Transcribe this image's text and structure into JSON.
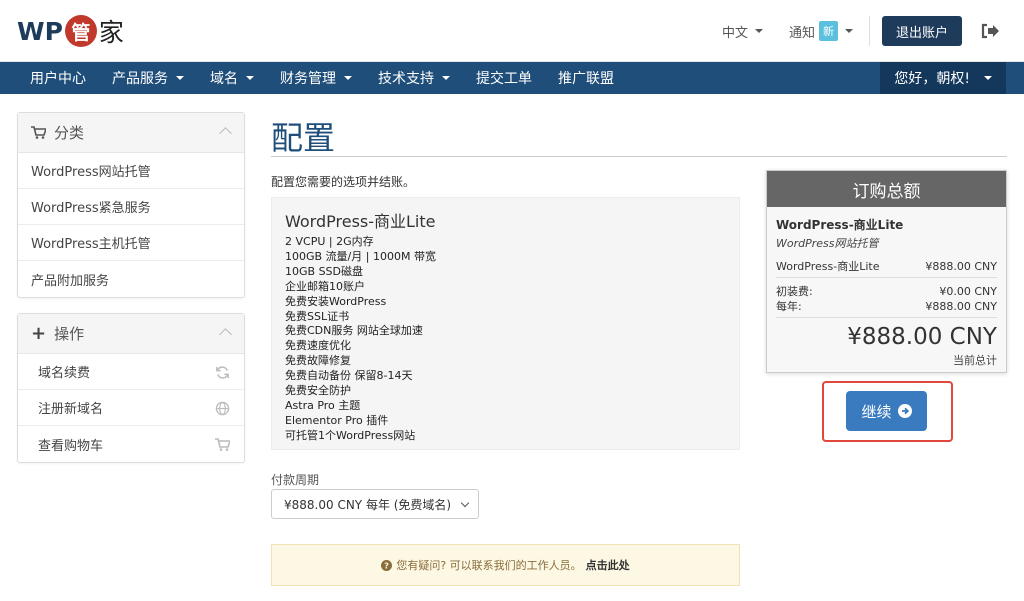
{
  "header": {
    "logo_prefix": "WP",
    "logo_seal": "管",
    "logo_suffix": "家",
    "lang": "中文",
    "notice_label": "通知",
    "notice_badge": "新",
    "logout_button": "退出账户"
  },
  "nav": {
    "items": [
      {
        "label": "用户中心",
        "dropdown": false
      },
      {
        "label": "产品服务",
        "dropdown": true
      },
      {
        "label": "域名",
        "dropdown": true
      },
      {
        "label": "财务管理",
        "dropdown": true
      },
      {
        "label": "技术支持",
        "dropdown": true
      },
      {
        "label": "提交工单",
        "dropdown": false
      },
      {
        "label": "推广联盟",
        "dropdown": false
      }
    ],
    "greeting": "您好，朝权!"
  },
  "sidebar": {
    "categories": {
      "title": "分类",
      "items": [
        "WordPress网站托管",
        "WordPress紧急服务",
        "WordPress主机托管",
        "产品附加服务"
      ]
    },
    "actions": {
      "title": "操作",
      "items": [
        {
          "label": "域名续费",
          "icon": "refresh-icon"
        },
        {
          "label": "注册新域名",
          "icon": "globe-icon"
        },
        {
          "label": "查看购物车",
          "icon": "cart-icon"
        }
      ]
    }
  },
  "main": {
    "title": "配置",
    "intro": "配置您需要的选项并结账。",
    "product": {
      "name": "WordPress-商业Lite",
      "features": [
        "2 VCPU | 2G内存",
        "100GB 流量/月 | 1000M 带宽",
        "10GB SSD磁盘",
        "企业邮箱10账户",
        "免费安装WordPress",
        "免费SSL证书",
        "免费CDN服务 网站全球加速",
        "免费速度优化",
        "免费故障修复",
        "免费自动备份 保留8-14天",
        "免费安全防护",
        "Astra Pro 主题",
        "Elementor Pro 插件",
        "可托管1个WordPress网站"
      ]
    },
    "billing_label": "付款周期",
    "billing_selected": "¥888.00 CNY 每年 (免费域名)",
    "help_text": "您有疑问? 可以联系我们的工作人员。",
    "help_link": "点击此处"
  },
  "summary": {
    "title": "订购总额",
    "product": "WordPress-商业Lite",
    "group": "WordPress网站托管",
    "line_label": "WordPress-商业Lite",
    "line_price": "¥888.00 CNY",
    "setup_label": "初装费:",
    "setup_price": "¥0.00 CNY",
    "annual_label": "每年:",
    "annual_price": "¥888.00 CNY",
    "total": "¥888.00 CNY",
    "total_note": "当前总计"
  },
  "continue_button": "继续",
  "colors": {
    "brand_navy": "#1f3b5c",
    "nav_blue": "#1f4e7a",
    "button_blue": "#3a7bbf",
    "highlight_red": "#e0483c",
    "seal_red": "#c0392b"
  }
}
